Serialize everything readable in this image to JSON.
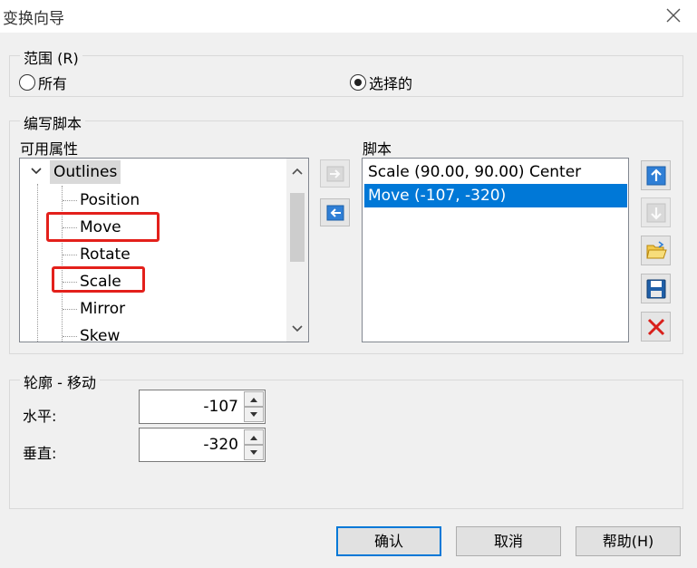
{
  "window": {
    "title": "变换向导"
  },
  "range": {
    "group_label": "范围 (R)",
    "options": [
      {
        "label": "所有",
        "selected": false
      },
      {
        "label": "选择的",
        "selected": true
      }
    ]
  },
  "script_editor": {
    "group_label": "编写脚本",
    "available_label": "可用属性",
    "tree": {
      "root": "Outlines",
      "children": [
        "Position",
        "Move",
        "Rotate",
        "Scale",
        "Mirror",
        "Skew"
      ]
    },
    "script_label": "脚本",
    "script_items": [
      {
        "text": "Scale (90.00, 90.00) Center",
        "selected": false
      },
      {
        "text": "Move (-107, -320)",
        "selected": true
      }
    ]
  },
  "outline_move": {
    "group_label": "轮廓 - 移动",
    "horizontal_label": "水平:",
    "horizontal_value": "-107",
    "vertical_label": "垂直:",
    "vertical_value": "-320"
  },
  "buttons": {
    "ok": "确认",
    "cancel": "取消",
    "help": "帮助(H)"
  },
  "colors": {
    "selection": "#0078d7",
    "highlight": "#e3201b",
    "delete": "#d9201b"
  }
}
